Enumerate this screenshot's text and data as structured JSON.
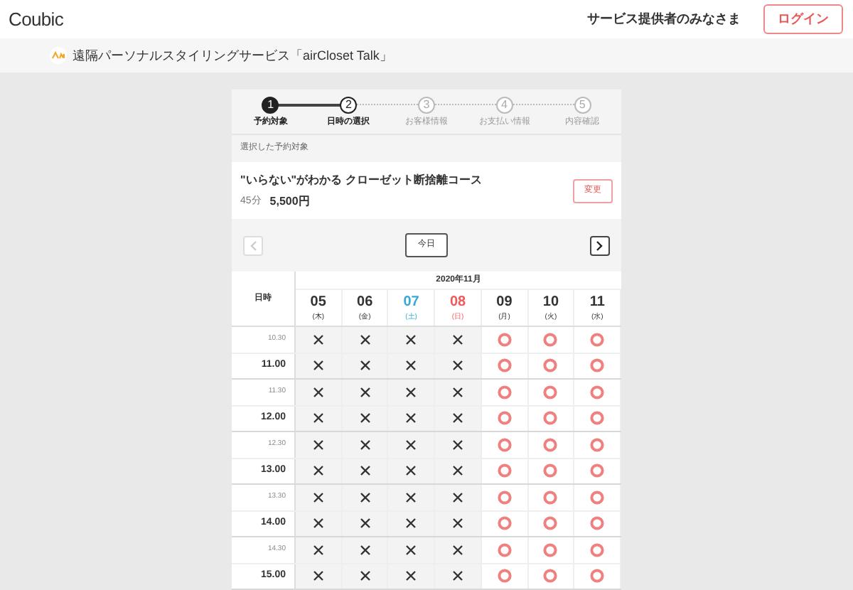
{
  "header": {
    "logo": "Coubic",
    "provider_link": "サービス提供者のみなさま",
    "login_button": "ログイン"
  },
  "service_bar": {
    "title": "遠隔パーソナルスタイリングサービス「airCloset Talk」"
  },
  "steps": [
    {
      "number": "1",
      "label": "予約対象",
      "kind": "done"
    },
    {
      "number": "2",
      "label": "日時の選択",
      "kind": "current"
    },
    {
      "number": "3",
      "label": "お客様情報",
      "kind": "todo"
    },
    {
      "number": "4",
      "label": "お支払い情報",
      "kind": "todo"
    },
    {
      "number": "5",
      "label": "内容確認",
      "kind": "todo"
    }
  ],
  "selected_section": {
    "heading": "選択した予約対象",
    "course_name": "\"いらない\"がわかる クローゼット断捨離コース",
    "duration": "45分",
    "price": "5,500円",
    "change_button": "変更"
  },
  "calendar": {
    "prev_disabled": true,
    "next_disabled": false,
    "today_button": "今日",
    "month": "2020年11月",
    "time_heading": "日時",
    "days": [
      {
        "date": "05",
        "weekday": "(木)",
        "kind": "weekday"
      },
      {
        "date": "06",
        "weekday": "(金)",
        "kind": "weekday"
      },
      {
        "date": "07",
        "weekday": "(土)",
        "kind": "saturday"
      },
      {
        "date": "08",
        "weekday": "(日)",
        "kind": "sunday"
      },
      {
        "date": "09",
        "weekday": "(月)",
        "kind": "weekday"
      },
      {
        "date": "10",
        "weekday": "(火)",
        "kind": "weekday"
      },
      {
        "date": "11",
        "weekday": "(水)",
        "kind": "weekday"
      }
    ],
    "rows": [
      {
        "time": "10.30",
        "kind": "half",
        "slots": [
          false,
          false,
          false,
          false,
          true,
          true,
          true
        ]
      },
      {
        "time": "11.00",
        "kind": "hour",
        "slots": [
          false,
          false,
          false,
          false,
          true,
          true,
          true
        ]
      },
      {
        "time": "11.30",
        "kind": "half",
        "slots": [
          false,
          false,
          false,
          false,
          true,
          true,
          true
        ]
      },
      {
        "time": "12.00",
        "kind": "hour",
        "slots": [
          false,
          false,
          false,
          false,
          true,
          true,
          true
        ]
      },
      {
        "time": "12.30",
        "kind": "half",
        "slots": [
          false,
          false,
          false,
          false,
          true,
          true,
          true
        ]
      },
      {
        "time": "13.00",
        "kind": "hour",
        "slots": [
          false,
          false,
          false,
          false,
          true,
          true,
          true
        ]
      },
      {
        "time": "13.30",
        "kind": "half",
        "slots": [
          false,
          false,
          false,
          false,
          true,
          true,
          true
        ]
      },
      {
        "time": "14.00",
        "kind": "hour",
        "slots": [
          false,
          false,
          false,
          false,
          true,
          true,
          true
        ]
      },
      {
        "time": "14.30",
        "kind": "half",
        "slots": [
          false,
          false,
          false,
          false,
          true,
          true,
          true
        ]
      },
      {
        "time": "15.00",
        "kind": "hour",
        "slots": [
          false,
          false,
          false,
          false,
          true,
          true,
          true
        ]
      }
    ]
  }
}
